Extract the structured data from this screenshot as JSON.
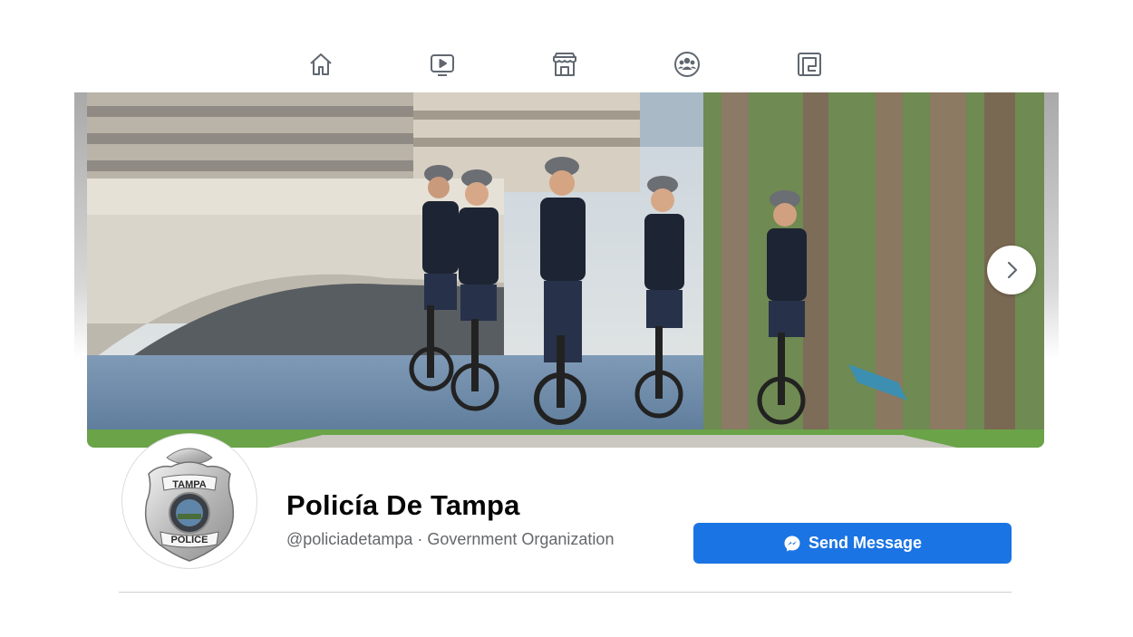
{
  "nav": {
    "icons": [
      "home-icon",
      "watch-icon",
      "marketplace-icon",
      "groups-icon",
      "gaming-icon"
    ]
  },
  "cover": {
    "next_icon": "chevron-right-icon"
  },
  "profile": {
    "badge_top_text": "TAMPA",
    "badge_bottom_text": "POLICE",
    "name": "Policía De Tampa",
    "subtitle": "@policiadetampa · Government Organization"
  },
  "actions": {
    "send_message_label": "Send Message",
    "send_message_icon": "messenger-icon",
    "accent_color": "#1b74e4"
  }
}
